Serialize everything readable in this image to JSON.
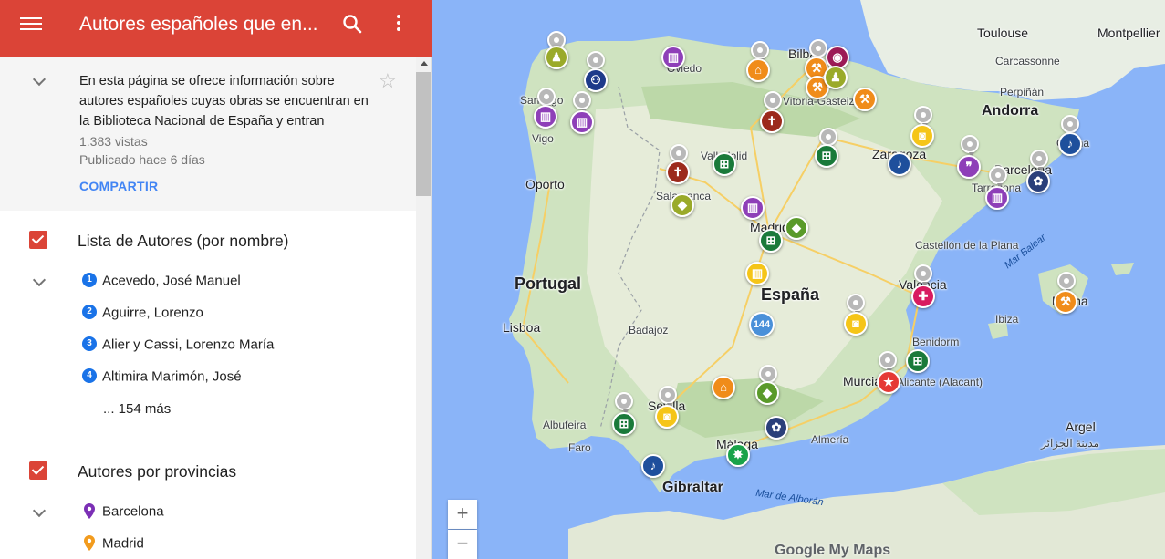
{
  "header": {
    "title": "Autores españoles que en...",
    "menu_icon": "hamburger-menu-icon",
    "search_icon": "search-icon",
    "more_icon": "more-vert-icon"
  },
  "description": {
    "text": "En esta página se ofrece información sobre autores españoles cuyas obras se encuentran en la Biblioteca Nacional de España y entran",
    "views": "1.383 vistas",
    "published": "Publicado hace 6 días",
    "share_label": "COMPARTIR",
    "star_icon": "star-outline-icon"
  },
  "layers": [
    {
      "title": "Lista de Autores (por nombre)",
      "items": [
        {
          "num": "1",
          "label": "Acevedo, José Manuel"
        },
        {
          "num": "2",
          "label": "Aguirre, Lorenzo"
        },
        {
          "num": "3",
          "label": "Alier y Cassi, Lorenzo María"
        },
        {
          "num": "4",
          "label": "Altimira Marimón, José"
        }
      ],
      "more": "... 154 más"
    },
    {
      "title": "Autores por provincias",
      "items": [
        {
          "label": "Barcelona",
          "color": "#7b2fb5"
        },
        {
          "label": "Madrid",
          "color": "#f29b1d"
        }
      ]
    }
  ],
  "map": {
    "labels": {
      "toulouse": "Toulouse",
      "montpellier": "Montpellier",
      "carcassonne": "Carcassonne",
      "perpignan": "Perpiñán",
      "andorra": "Andorra",
      "girona": "Girona",
      "barcelona": "Barcelona",
      "tarragona": "Tarragona",
      "zaragoza": "Zaragoza",
      "bilbao": "Bilbao",
      "vitoria": "Vitoria-Gasteiz",
      "oviedo": "Oviedo",
      "santiago": "Santiago",
      "vigo": "Vigo",
      "porto": "Oporto",
      "valladolid": "Valladolid",
      "salamanca": "Salamanca",
      "madrid": "Madrid",
      "portugal": "Portugal",
      "lisboa": "Lisboa",
      "espana": "España",
      "badajoz": "Badajoz",
      "castellon": "Castellón de la Plana",
      "valencia": "Valencia",
      "ibiza": "Ibiza",
      "palma": "Palma",
      "benidorm": "Benidorm",
      "alicante": "Alicante (Alacant)",
      "murcia": "Murcia",
      "sevilla": "Sevilla",
      "albufeira": "Albufeira",
      "faro": "Faro",
      "malaga": "Málaga",
      "almeria": "Almería",
      "gibraltar": "Gibraltar",
      "argel": "Argel",
      "argel_ar": "مدينة الجزائر",
      "mar_balear": "Mar Balear",
      "mar_alboran": "Mar de Alborán"
    },
    "cluster_count": "144",
    "zoom_in": "+",
    "zoom_out": "−",
    "logo": "Google My Maps"
  }
}
